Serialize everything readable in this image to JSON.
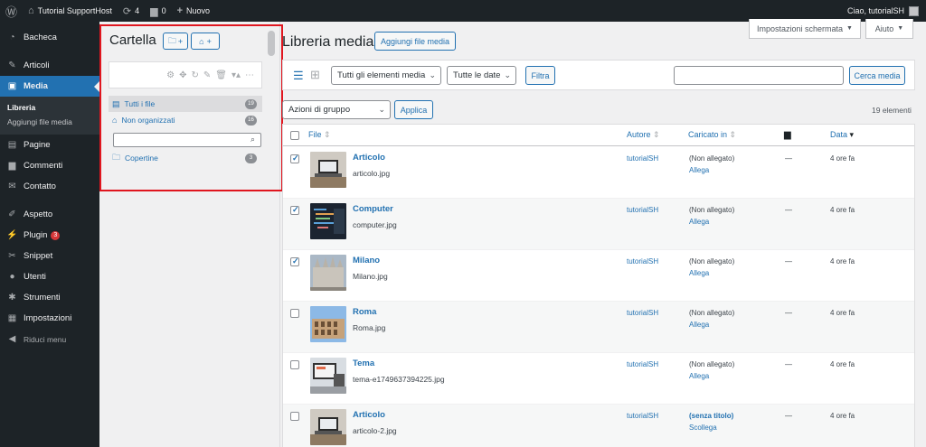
{
  "admin_bar": {
    "site_name": "Tutorial SupportHost",
    "updates_count": "4",
    "comments_count": "0",
    "new_label": "Nuovo",
    "greeting": "Ciao, tutorialSH"
  },
  "sidebar": {
    "items": [
      {
        "label": "Bacheca",
        "icon": "dashboard-icon"
      },
      {
        "label": "Articoli",
        "icon": "pin-icon"
      },
      {
        "label": "Media",
        "icon": "media-icon"
      },
      {
        "label": "Pagine",
        "icon": "page-icon"
      },
      {
        "label": "Commenti",
        "icon": "comment-icon"
      },
      {
        "label": "Contatto",
        "icon": "mail-icon"
      },
      {
        "label": "Aspetto",
        "icon": "brush-icon"
      },
      {
        "label": "Plugin",
        "icon": "plugin-icon",
        "badge": "3"
      },
      {
        "label": "Snippet",
        "icon": "scissors-icon"
      },
      {
        "label": "Utenti",
        "icon": "user-icon"
      },
      {
        "label": "Strumenti",
        "icon": "wrench-icon"
      },
      {
        "label": "Impostazioni",
        "icon": "settings-icon"
      },
      {
        "label": "Riduci menu",
        "icon": "collapse-icon"
      }
    ],
    "submenu": [
      "Libreria",
      "Aggiungi file media"
    ]
  },
  "folders": {
    "title": "Cartella",
    "new_folder_label": "+",
    "new_root_label": "+",
    "items": [
      {
        "label": "Tutti i file",
        "count": "19"
      },
      {
        "label": "Non organizzati",
        "count": "16"
      },
      {
        "label": "Copertine",
        "count": "3"
      }
    ]
  },
  "main": {
    "title": "Libreria media",
    "add_button": "Aggiungi file media",
    "screen_options": "Impostazioni schermata",
    "help": "Aiuto",
    "filter_type": "Tutti gli elementi media",
    "filter_date": "Tutte le date",
    "filter_button": "Filtra",
    "search_button": "Cerca media",
    "bulk_actions": "Azioni di gruppo",
    "apply_button": "Applica",
    "items_count": "19 elementi"
  },
  "table": {
    "headers": {
      "file": "File",
      "author": "Autore",
      "uploaded": "Caricato in",
      "date": "Data"
    },
    "rows": [
      {
        "title": "Articolo",
        "file": "articolo.jpg",
        "author": "tutorialSH",
        "uploaded": "(Non allegato)",
        "action": "Allega",
        "comments": "—",
        "date": "4 ore fa",
        "checked": true,
        "thumb": "laptop"
      },
      {
        "title": "Computer",
        "file": "computer.jpg",
        "author": "tutorialSH",
        "uploaded": "(Non allegato)",
        "action": "Allega",
        "comments": "—",
        "date": "4 ore fa",
        "checked": true,
        "thumb": "code"
      },
      {
        "title": "Milano",
        "file": "Milano.jpg",
        "author": "tutorialSH",
        "uploaded": "(Non allegato)",
        "action": "Allega",
        "comments": "—",
        "date": "4 ore fa",
        "checked": true,
        "thumb": "cathedral"
      },
      {
        "title": "Roma",
        "file": "Roma.jpg",
        "author": "tutorialSH",
        "uploaded": "(Non allegato)",
        "action": "Allega",
        "comments": "—",
        "date": "4 ore fa",
        "checked": false,
        "thumb": "colosseum"
      },
      {
        "title": "Tema",
        "file": "tema-e1749637394225.jpg",
        "author": "tutorialSH",
        "uploaded": "(Non allegato)",
        "action": "Allega",
        "comments": "—",
        "date": "4 ore fa",
        "checked": false,
        "thumb": "screen"
      },
      {
        "title": "Articolo",
        "file": "articolo-2.jpg",
        "author": "tutorialSH",
        "uploaded": "(senza titolo)",
        "action": "Scollega",
        "comments": "—",
        "date": "4 ore fa",
        "checked": false,
        "thumb": "laptop"
      }
    ]
  }
}
